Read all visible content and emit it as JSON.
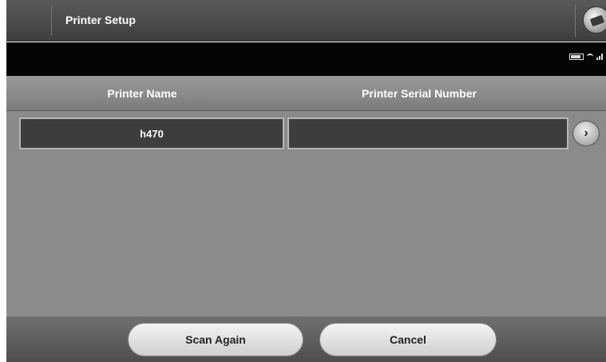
{
  "window": {
    "title": "Printer Setup",
    "app_icon": "programmer-app-icon"
  },
  "status": {
    "icons": [
      "battery-icon",
      "wifi-icon",
      "signal-icon"
    ]
  },
  "table": {
    "headers": {
      "name": "Printer Name",
      "serial": "Printer Serial Number"
    },
    "rows": [
      {
        "name": "h470",
        "serial": "",
        "action_icon": "chevron-right-icon"
      }
    ]
  },
  "footer": {
    "scan_again": "Scan Again",
    "cancel": "Cancel"
  },
  "colors": {
    "titlebar": "#4a4a4a",
    "statusbar": "#050505",
    "cell": "#3d3d3d",
    "panel": "#8a8a8a"
  }
}
